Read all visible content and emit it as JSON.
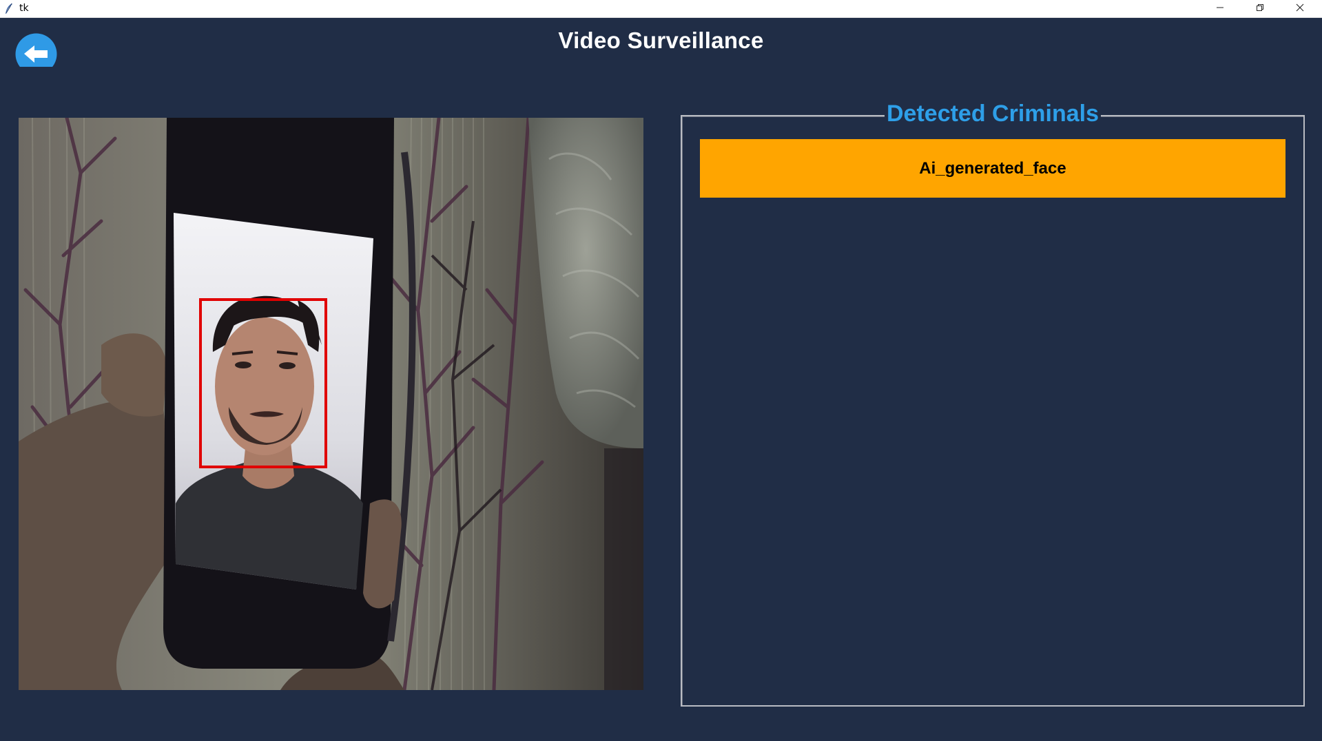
{
  "window": {
    "title": "tk",
    "icon": "tk-feather-icon",
    "controls": [
      "minimize-icon",
      "maximize-icon",
      "close-icon"
    ]
  },
  "header": {
    "title": "Video Surveillance",
    "back_icon": "arrow-left-icon"
  },
  "video_feed": {
    "content": "camera-frame",
    "detection_box_color": "#e00000"
  },
  "detected_panel": {
    "legend": "Detected Criminals",
    "items": [
      {
        "label": "Ai_generated_face"
      }
    ]
  },
  "colors": {
    "background": "#202d46",
    "accent": "#2e9fe8",
    "item": "#ffa500",
    "title_text": "#ffffff"
  }
}
